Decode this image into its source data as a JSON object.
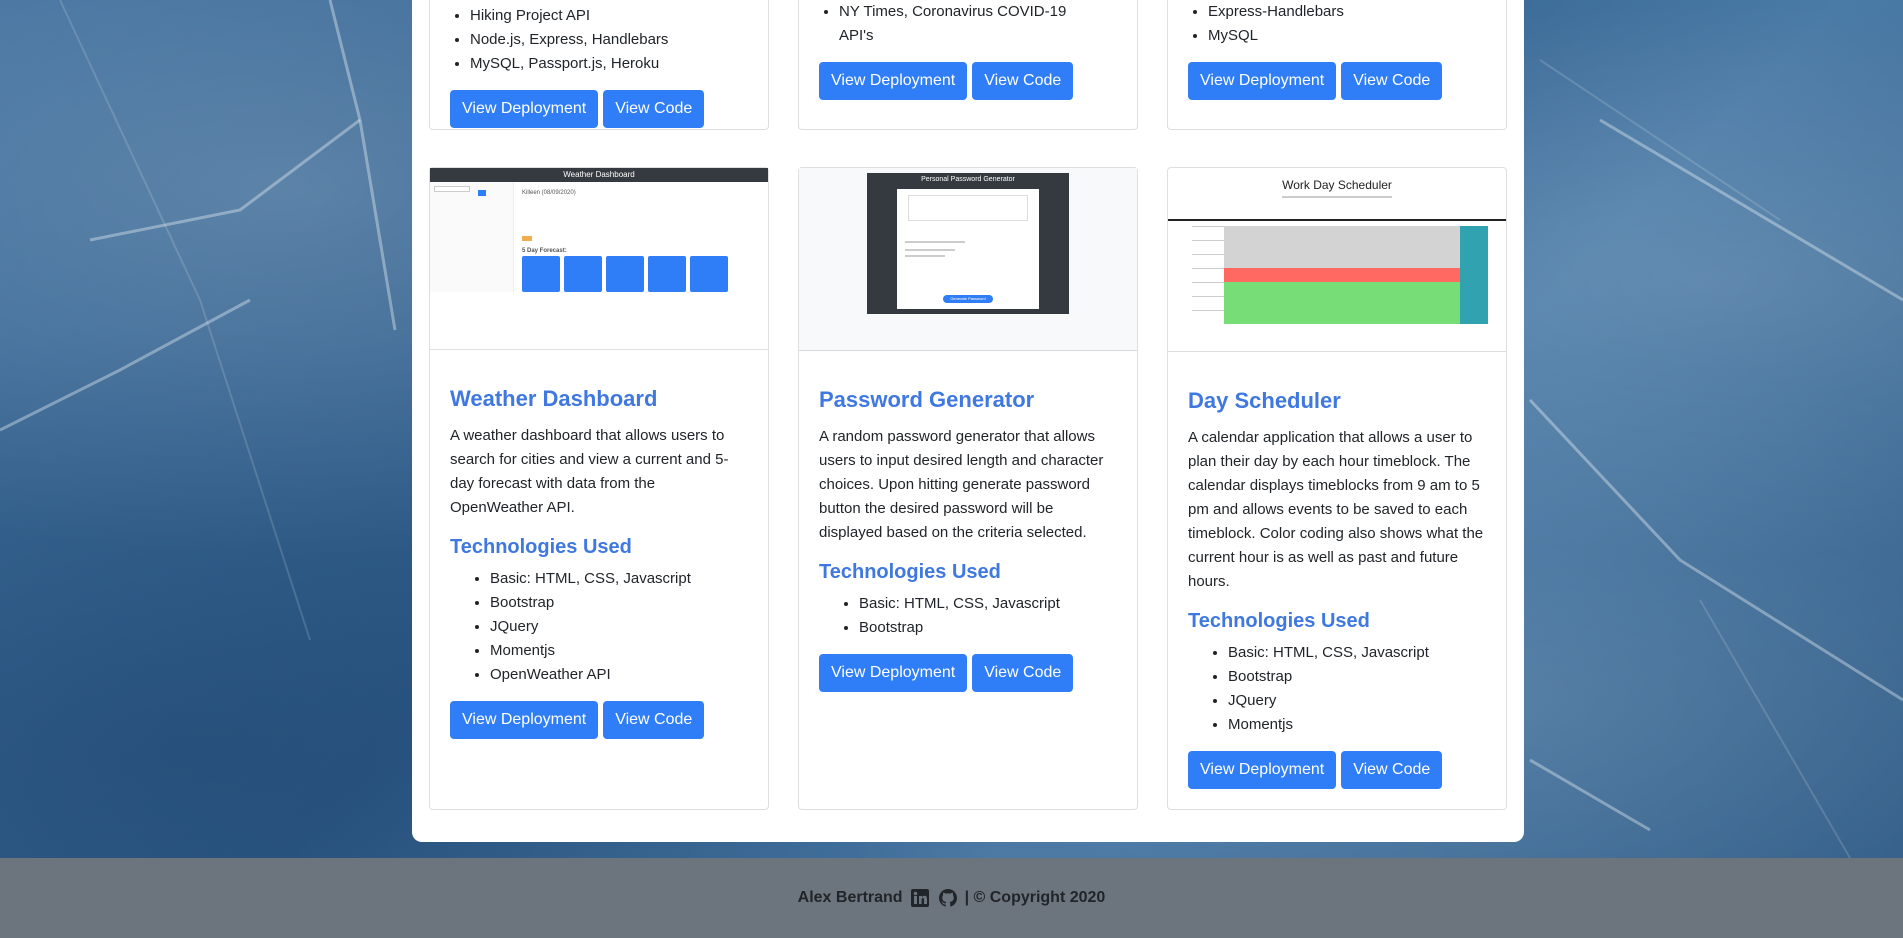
{
  "top_cards": [
    {
      "tech": [
        "Hiking Project API",
        "Node.js, Express, Handlebars",
        "MySQL, Passport.js, Heroku"
      ],
      "deploy": "View Deployment",
      "code": "View Code"
    },
    {
      "tech": [
        "NY Times, Coronavirus COVID-19 API's"
      ],
      "deploy": "View Deployment",
      "code": "View Code"
    },
    {
      "tech": [
        "Express-Handlebars",
        "MySQL"
      ],
      "deploy": "View Deployment",
      "code": "View Code"
    }
  ],
  "cards": [
    {
      "title": "Weather Dashboard",
      "description": "A weather dashboard that allows users to search for cities and view a current and 5-day forecast with data from the OpenWeather API.",
      "tech_heading": "Technologies Used",
      "tech": [
        "Basic: HTML, CSS, Javascript",
        "Bootstrap",
        "JQuery",
        "Momentjs",
        "OpenWeather API"
      ],
      "deploy": "View Deployment",
      "code": "View Code",
      "thumb": {
        "header": "Weather Dashboard",
        "city": "Killeen (08/09/2020)",
        "forecast": "5 Day Forecast:"
      }
    },
    {
      "title": "Password Generator",
      "description": "A random password generator that allows users to input desired length and character choices. Upon hitting generate password button the desired password will be displayed based on the criteria selected.",
      "tech_heading": "Technologies Used",
      "tech": [
        "Basic: HTML, CSS, Javascript",
        "Bootstrap"
      ],
      "deploy": "View Deployment",
      "code": "View Code",
      "thumb": {
        "header": "Personal Password Generator",
        "button": "Generate Password"
      }
    },
    {
      "title": "Day Scheduler",
      "description": "A calendar application that allows a user to plan their day by each hour timeblock. The calendar displays timeblocks from 9 am to 5 pm and allows events to be saved to each timeblock. Color coding also shows what the current hour is as well as past and future hours.",
      "tech_heading": "Technologies Used",
      "tech": [
        "Basic: HTML, CSS, Javascript",
        "Bootstrap",
        "JQuery",
        "Momentjs"
      ],
      "deploy": "View Deployment",
      "code": "View Code",
      "thumb": {
        "header": "Work Day Scheduler"
      }
    }
  ],
  "footer": {
    "name": "Alex Bertrand",
    "copyright": "| © Copyright 2020"
  },
  "colors": {
    "accent": "#3f78e0",
    "button": "#2f7ef7",
    "footer_bg": "#6c757d",
    "past": "#d3d3d3",
    "present": "#ff6961",
    "future": "#77dd77",
    "save": "#31a3b0"
  }
}
